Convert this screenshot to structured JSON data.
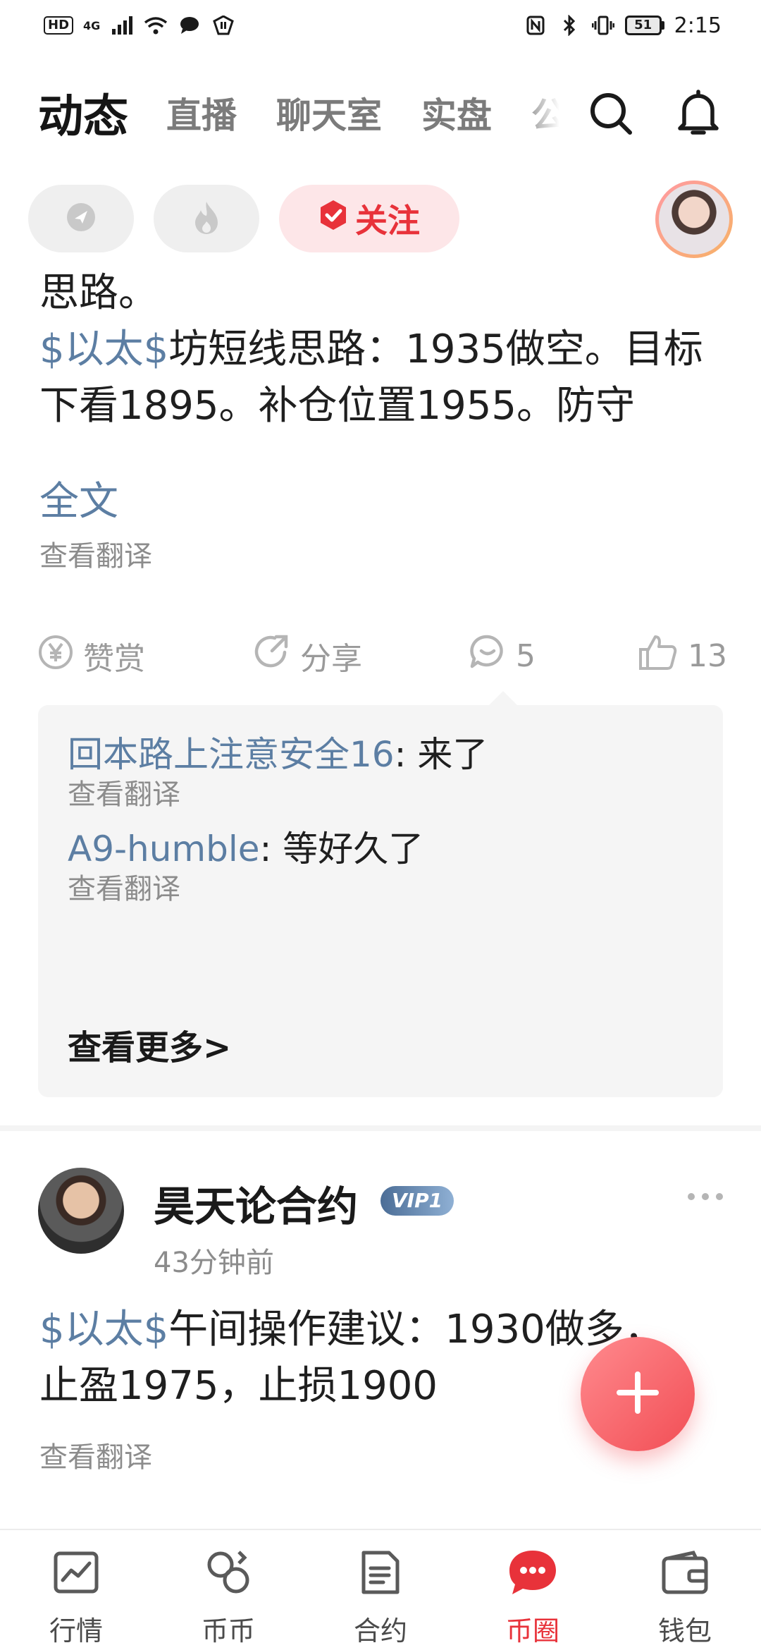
{
  "status_bar": {
    "hd_badge": "HD",
    "network": "4G",
    "battery": "51",
    "time": "2:15"
  },
  "top_nav": {
    "tabs": [
      {
        "label": "动态",
        "active": true
      },
      {
        "label": "直播",
        "active": false
      },
      {
        "label": "聊天室",
        "active": false
      },
      {
        "label": "实盘",
        "active": false
      },
      {
        "label": "公",
        "active": false
      }
    ],
    "icons": [
      "search-icon",
      "bell-icon"
    ]
  },
  "filters": {
    "chips": [
      {
        "icon": "send-icon"
      },
      {
        "icon": "flame-icon"
      },
      {
        "icon": "shield-check-icon",
        "label": "关注"
      }
    ]
  },
  "post1": {
    "text_line1": "思路。",
    "tag": "$以太$",
    "text_rest": "坊短线思路：1935做空。目标下看1895。补仓位置1955。防守",
    "full_text_link": "全文",
    "translate": "查看翻译",
    "actions": {
      "reward": "赞赏",
      "share": "分享",
      "comments": "5",
      "likes": "13"
    },
    "comments": [
      {
        "user": "回本路上注意安全16",
        "text": "来了",
        "translate": "查看翻译"
      },
      {
        "user": "A9-humble",
        "text": "等好久了",
        "translate": "查看翻译"
      }
    ],
    "view_more": "查看更多>"
  },
  "post2": {
    "author": "昊天论合约",
    "vip": "VIP1",
    "time": "43分钟前",
    "tag": "$以太$",
    "text_a": "午间操作建议：1930做多，",
    "text_b": "止盈1975，止损1900",
    "translate": "查看翻译"
  },
  "bottom_nav": {
    "items": [
      {
        "label": "行情",
        "icon": "chart-icon",
        "active": false
      },
      {
        "label": "币币",
        "icon": "coins-exchange-icon",
        "active": false
      },
      {
        "label": "合约",
        "icon": "contract-icon",
        "active": false
      },
      {
        "label": "币圈",
        "icon": "chat-bubble-icon",
        "active": true
      },
      {
        "label": "钱包",
        "icon": "wallet-icon",
        "active": false
      }
    ]
  },
  "colors": {
    "accent_red": "#e8323a",
    "link_blue": "#5c7ea3",
    "muted_gray": "#8c8c8c"
  }
}
